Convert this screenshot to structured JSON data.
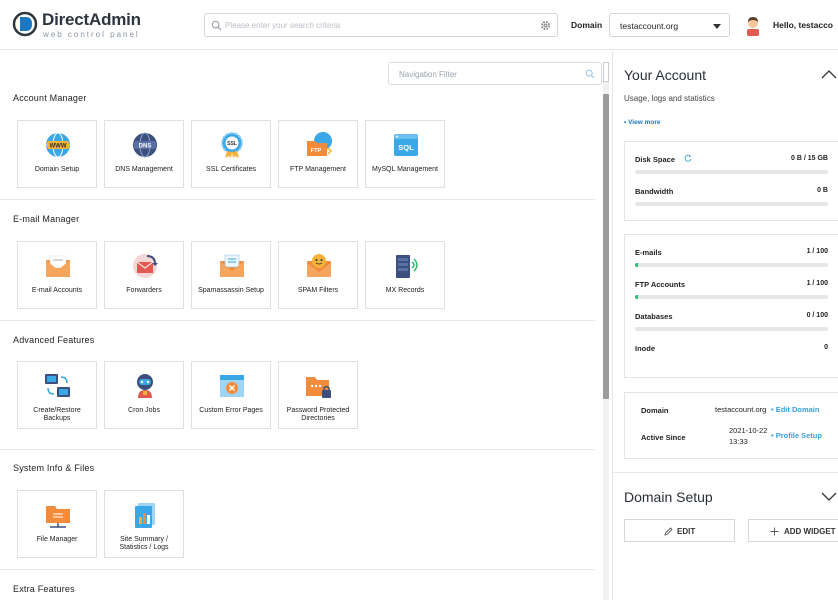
{
  "header": {
    "logo_name": "DirectAdmin",
    "logo_tagline": "web control panel",
    "search_placeholder": "Please enter your search criteria",
    "domain_label": "Domain",
    "domain_selected": "testaccount.org",
    "greeting": "Hello, testacco"
  },
  "nav_filter": {
    "placeholder": "Navigation Filter"
  },
  "sections": [
    {
      "title": "Account Manager",
      "items": [
        {
          "label": "Domain Setup",
          "icon": "globe-www-icon"
        },
        {
          "label": "DNS Management",
          "icon": "dns-globe-icon"
        },
        {
          "label": "SSL Certificates",
          "icon": "ssl-badge-icon"
        },
        {
          "label": "FTP Management",
          "icon": "ftp-folder-icon"
        },
        {
          "label": "MySQL Management",
          "icon": "sql-database-icon"
        }
      ]
    },
    {
      "title": "E-mail Manager",
      "items": [
        {
          "label": "E-mail Accounts",
          "icon": "envelope-icon"
        },
        {
          "label": "Forwarders",
          "icon": "forward-mail-icon"
        },
        {
          "label": "Spamassassin Setup",
          "icon": "spam-envelope-icon"
        },
        {
          "label": "SPAM Filters",
          "icon": "spam-filter-icon"
        },
        {
          "label": "MX Records",
          "icon": "mx-server-icon"
        }
      ]
    },
    {
      "title": "Advanced Features",
      "items": [
        {
          "label": "Create/Restore Backups",
          "icon": "backup-monitors-icon"
        },
        {
          "label": "Cron Jobs",
          "icon": "cron-robot-icon"
        },
        {
          "label": "Custom Error Pages",
          "icon": "error-page-icon"
        },
        {
          "label": "Password Protected Directories",
          "icon": "locked-folder-icon"
        }
      ]
    },
    {
      "title": "System Info & Files",
      "items": [
        {
          "label": "File Manager",
          "icon": "file-folder-icon"
        },
        {
          "label": "Site Summary / Statistics / Logs",
          "icon": "statistics-icon"
        }
      ]
    },
    {
      "title": "Extra Features",
      "items": []
    }
  ],
  "your_account": {
    "title": "Your Account",
    "subtitle": "Usage, logs and statistics",
    "view_more": "• View more",
    "disk_space_label": "Disk Space",
    "disk_space_value": "0 B / 15 GB",
    "disk_space_fraction": 0,
    "bandwidth_label": "Bandwidth",
    "bandwidth_value": "0 B",
    "bandwidth_fraction": 0,
    "emails_label": "E-mails",
    "emails_value": "1 / 100",
    "emails_fraction": 0.01,
    "ftp_label": "FTP Accounts",
    "ftp_value": "1 / 100",
    "ftp_fraction": 0.01,
    "db_label": "Databases",
    "db_value": "0 / 100",
    "db_fraction": 0,
    "inode_label": "Inode",
    "inode_value": "0",
    "domain_label": "Domain",
    "domain_value": "testaccount.org",
    "edit_domain": "• Edit Domain",
    "active_since_label": "Active Since",
    "active_since_date": "2021-10-22",
    "active_since_time": "13:33",
    "profile_setup": "• Profile Setup"
  },
  "domain_setup_panel": {
    "title": "Domain Setup",
    "edit_label": "EDIT",
    "add_widget_label": "ADD WIDGET"
  },
  "colors": {
    "accent": "#1a78c2",
    "link": "#3aa0d8",
    "progress": "#2fbf71"
  }
}
